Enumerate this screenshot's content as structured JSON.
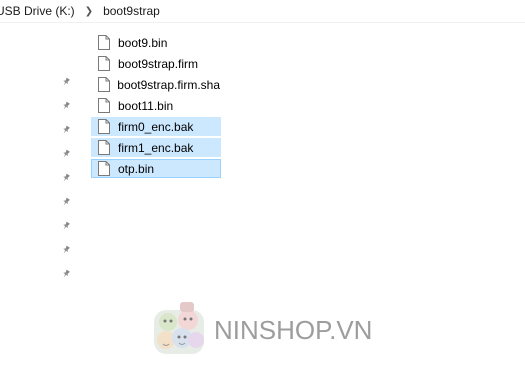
{
  "breadcrumb": {
    "items": [
      "USB Drive (K:)",
      "boot9strap"
    ]
  },
  "quick_access_pins": 9,
  "files": [
    {
      "name": "boot9.bin",
      "selected": false,
      "focused": false
    },
    {
      "name": "boot9strap.firm",
      "selected": false,
      "focused": false
    },
    {
      "name": "boot9strap.firm.sha",
      "selected": false,
      "focused": false
    },
    {
      "name": "boot11.bin",
      "selected": false,
      "focused": false
    },
    {
      "name": "firm0_enc.bak",
      "selected": true,
      "focused": false
    },
    {
      "name": "firm1_enc.bak",
      "selected": true,
      "focused": false
    },
    {
      "name": "otp.bin",
      "selected": true,
      "focused": true
    }
  ],
  "watermark": {
    "text": "NINSHOP.VN"
  },
  "colors": {
    "selection": "#cce8ff",
    "focus_border": "#99d1ff",
    "watermark": "#9d9d9d"
  }
}
